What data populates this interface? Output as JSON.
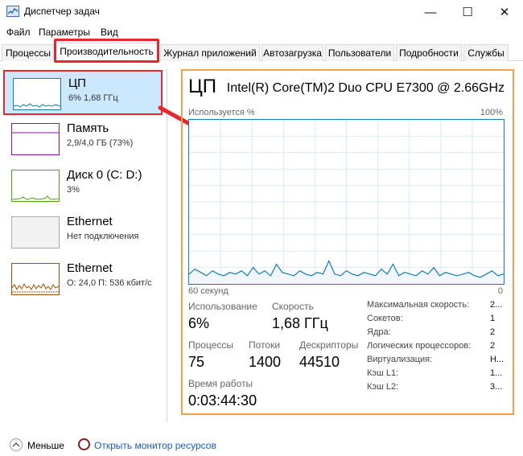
{
  "window": {
    "title": "Диспетчер задач",
    "controls": {
      "minimize": "—",
      "maximize": "☐",
      "close": "✕"
    }
  },
  "menu": [
    "Файл",
    "Параметры",
    "Вид"
  ],
  "tabs": [
    {
      "label": "Процессы"
    },
    {
      "label": "Производительность",
      "active": true
    },
    {
      "label": "Журнал приложений"
    },
    {
      "label": "Автозагрузка"
    },
    {
      "label": "Пользователи"
    },
    {
      "label": "Подробности"
    },
    {
      "label": "Службы"
    }
  ],
  "sidebar": {
    "items": [
      {
        "name": "ЦП",
        "sub": "6% 1,68 ГГц",
        "color": "#117dbb",
        "selected": true
      },
      {
        "name": "Память",
        "sub": "2,9/4,0 ГБ (73%)",
        "color": "#8b12ae"
      },
      {
        "name": "Диск 0 (C: D:)",
        "sub": "3%",
        "color": "#4da60c"
      },
      {
        "name": "Ethernet",
        "sub": "Нет подключения",
        "color": "#aaaaaa"
      },
      {
        "name": "Ethernet",
        "sub": "О: 24,0 П: 536 кбит/с",
        "color": "#a74f01"
      }
    ]
  },
  "main": {
    "title": "ЦП",
    "cpu_model": "Intel(R) Core(TM)2 Duo CPU E7300 @ 2.66GHz",
    "graph": {
      "y_label": "Используется %",
      "y_max_label": "100%",
      "x_left_label": "60 секунд",
      "x_right_label": "0",
      "line_color": "#117dbb",
      "values": [
        6,
        9,
        7,
        5,
        8,
        6,
        5,
        7,
        6,
        8,
        5,
        10,
        6,
        8,
        5,
        12,
        7,
        6,
        5,
        8,
        6,
        5,
        7,
        6,
        14,
        6,
        5,
        8,
        6,
        5,
        7,
        6,
        5,
        9,
        6,
        12,
        5,
        7,
        6,
        5,
        8,
        6,
        10,
        5,
        7,
        6,
        5,
        6,
        7,
        5,
        4,
        6,
        8,
        5,
        6
      ]
    },
    "stats": {
      "usage_label": "Использование",
      "usage_value": "6%",
      "speed_label": "Скорость",
      "speed_value": "1,68 ГГц",
      "processes_label": "Процессы",
      "processes_value": "75",
      "threads_label": "Потоки",
      "threads_value": "1400",
      "handles_label": "Дескрипторы",
      "handles_value": "44510",
      "uptime_label": "Время работы",
      "uptime_value": "0:03:44:30"
    },
    "specs": [
      {
        "label": "Максимальная скорость:",
        "value": "2..."
      },
      {
        "label": "Сокетов:",
        "value": "1"
      },
      {
        "label": "Ядра:",
        "value": "2"
      },
      {
        "label": "Логических процессоров:",
        "value": "2"
      },
      {
        "label": "Виртуализация:",
        "value": "Н..."
      },
      {
        "label": "Кэш L1:",
        "value": "1..."
      },
      {
        "label": "Кэш L2:",
        "value": "3..."
      }
    ]
  },
  "footer": {
    "fewer_label": "Меньше",
    "monitor_link": "Открыть монитор ресурсов"
  },
  "accent": {
    "highlight": "#e8262d",
    "panel_border": "#f0a050",
    "selected_bg": "#cce8ff"
  }
}
